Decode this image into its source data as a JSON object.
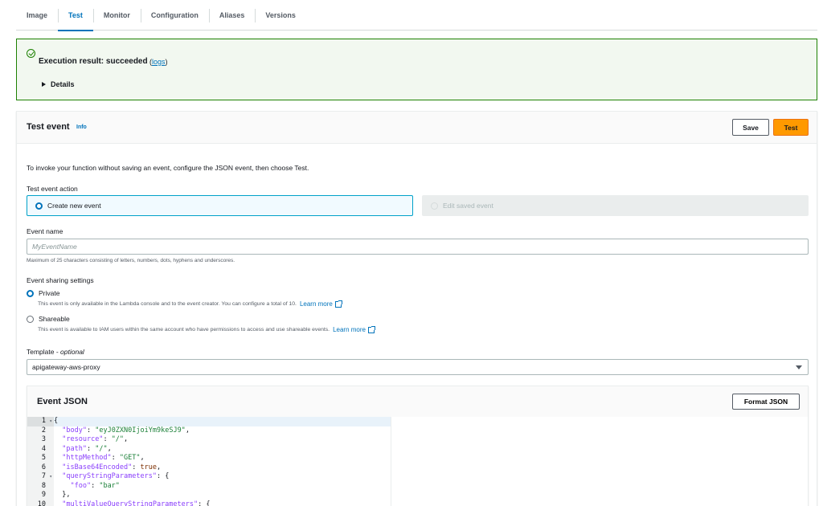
{
  "tabs": [
    {
      "label": "Image",
      "active": false
    },
    {
      "label": "Test",
      "active": true
    },
    {
      "label": "Monitor",
      "active": false
    },
    {
      "label": "Configuration",
      "active": false
    },
    {
      "label": "Aliases",
      "active": false
    },
    {
      "label": "Versions",
      "active": false
    }
  ],
  "banner": {
    "title": "Execution result: succeeded",
    "logs_open": "(",
    "logs_link": "logs",
    "logs_close": ")",
    "details": "Details",
    "color": "#1d8102"
  },
  "test_event": {
    "title": "Test event",
    "info": "Info",
    "save_label": "Save",
    "test_label": "Test",
    "description": "To invoke your function without saving an event, configure the JSON event, then choose Test.",
    "action_label": "Test event action",
    "create_new": "Create new event",
    "edit_saved": "Edit saved event",
    "event_name_label": "Event name",
    "event_name_placeholder": "MyEventName",
    "event_name_hint": "Maximum of 25 characters consisting of letters, numbers, dots, hyphens and underscores.",
    "sharing_label": "Event sharing settings",
    "private_label": "Private",
    "private_desc": "This event is only available in the Lambda console and to the event creator. You can configure a total of 10.",
    "shareable_label": "Shareable",
    "shareable_desc": "This event is available to IAM users within the same account who have permissions to access and use shareable events.",
    "learn_more": "Learn more",
    "template_label": "Template - ",
    "template_optional": "optional",
    "template_value": "apigateway-aws-proxy"
  },
  "event_json": {
    "title": "Event JSON",
    "format_label": "Format JSON",
    "lines": [
      {
        "n": "1",
        "fold": true,
        "parts": [
          [
            "p",
            "{"
          ]
        ]
      },
      {
        "n": "2",
        "fold": false,
        "parts": [
          [
            "p",
            "  "
          ],
          [
            "k",
            "\"body\""
          ],
          [
            "p",
            ": "
          ],
          [
            "s",
            "\"eyJ0ZXN0IjoiYm9keSJ9\""
          ],
          [
            "p",
            ","
          ]
        ]
      },
      {
        "n": "3",
        "fold": false,
        "parts": [
          [
            "p",
            "  "
          ],
          [
            "k",
            "\"resource\""
          ],
          [
            "p",
            ": "
          ],
          [
            "s",
            "\"/\""
          ],
          [
            "p",
            ","
          ]
        ]
      },
      {
        "n": "4",
        "fold": false,
        "parts": [
          [
            "p",
            "  "
          ],
          [
            "k",
            "\"path\""
          ],
          [
            "p",
            ": "
          ],
          [
            "s",
            "\"/\""
          ],
          [
            "p",
            ","
          ]
        ]
      },
      {
        "n": "5",
        "fold": false,
        "parts": [
          [
            "p",
            "  "
          ],
          [
            "k",
            "\"httpMethod\""
          ],
          [
            "p",
            ": "
          ],
          [
            "s",
            "\"GET\""
          ],
          [
            "p",
            ","
          ]
        ]
      },
      {
        "n": "6",
        "fold": false,
        "parts": [
          [
            "p",
            "  "
          ],
          [
            "k",
            "\"isBase64Encoded\""
          ],
          [
            "p",
            ": "
          ],
          [
            "k2",
            "true"
          ],
          [
            "p",
            ","
          ]
        ]
      },
      {
        "n": "7",
        "fold": true,
        "parts": [
          [
            "p",
            "  "
          ],
          [
            "k",
            "\"queryStringParameters\""
          ],
          [
            "p",
            ": {"
          ]
        ]
      },
      {
        "n": "8",
        "fold": false,
        "parts": [
          [
            "p",
            "    "
          ],
          [
            "k",
            "\"foo\""
          ],
          [
            "p",
            ": "
          ],
          [
            "s",
            "\"bar\""
          ]
        ]
      },
      {
        "n": "9",
        "fold": false,
        "parts": [
          [
            "p",
            "  },"
          ]
        ]
      },
      {
        "n": "10",
        "fold": false,
        "parts": [
          [
            "p",
            "  "
          ],
          [
            "k",
            "\"multiValueQueryStringParameters\""
          ],
          [
            "p",
            ": {"
          ]
        ]
      }
    ]
  }
}
